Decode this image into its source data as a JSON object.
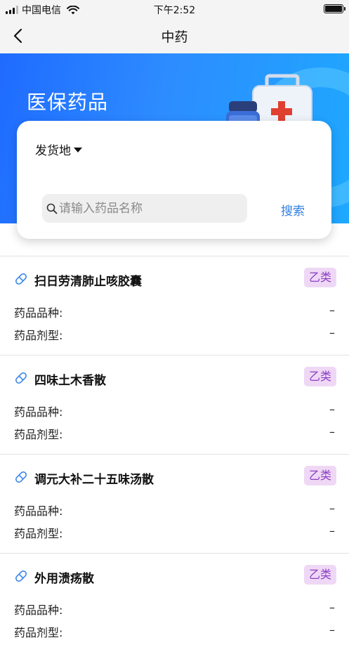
{
  "status_bar": {
    "carrier": "中国电信",
    "time": "下午2:52"
  },
  "nav": {
    "title": "中药"
  },
  "banner": {
    "title": "医保药品"
  },
  "search": {
    "location_label": "发货地",
    "placeholder": "请输入药品名称",
    "button_label": "搜索"
  },
  "list": {
    "items": [
      {
        "name": "扫日劳清肺止咳胶囊",
        "badge": "乙类",
        "variety_label": "药品品种:",
        "variety_value": "–",
        "form_label": "药品剂型:",
        "form_value": "–"
      },
      {
        "name": "四味土木香散",
        "badge": "乙类",
        "variety_label": "药品品种:",
        "variety_value": "–",
        "form_label": "药品剂型:",
        "form_value": "–"
      },
      {
        "name": "调元大补二十五味汤散",
        "badge": "乙类",
        "variety_label": "药品品种:",
        "variety_value": "–",
        "form_label": "药品剂型:",
        "form_value": "–"
      },
      {
        "name": "外用溃疡散",
        "badge": "乙类",
        "variety_label": "药品品种:",
        "variety_value": "–",
        "form_label": "药品剂型:",
        "form_value": "–"
      }
    ]
  },
  "icons": {
    "back": "chevron-left-icon",
    "wifi": "wifi-icon",
    "battery": "battery-icon",
    "search": "search-icon",
    "dropdown": "caret-down-icon",
    "drug": "pill-icon"
  },
  "colors": {
    "banner_gradient_start": "#1f6bff",
    "banner_gradient_end": "#1ea8ff",
    "search_button": "#2f7fe0",
    "badge_bg": "#efd8f5",
    "badge_text": "#8a3fc4"
  }
}
